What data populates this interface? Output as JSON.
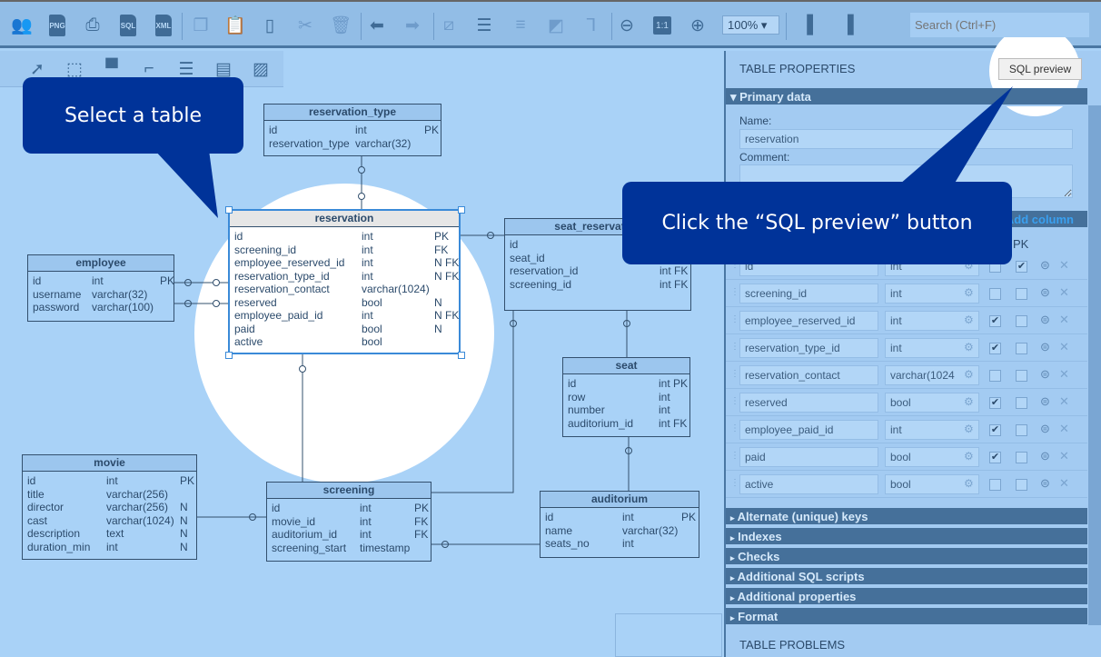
{
  "toolbar": {
    "icons": [
      "users-icon",
      "png-export-icon",
      "print-icon",
      "sql-export-icon",
      "xml-export-icon",
      "copy-icon",
      "paste-icon",
      "paste-special-icon",
      "cut-icon",
      "delete-icon",
      "undo-icon",
      "redo-icon",
      "line-style-icon",
      "align-icon",
      "distribute-icon",
      "arrange-icon",
      "connector-icon",
      "zoom-out-icon",
      "zoom-reset-icon",
      "zoom-in-icon",
      "layout-left-icon",
      "layout-right-icon"
    ],
    "zoom_reset_label": "1:1",
    "png_label": "PNG",
    "sql_label": "SQL",
    "xml_label": "XML",
    "zoom_value": "100%",
    "search_placeholder": "Search (Ctrl+F)"
  },
  "tools": [
    "select-tool-icon",
    "area-select-tool-icon",
    "table-tool-icon",
    "reference-tool-icon",
    "view-tool-icon",
    "note-tool-icon",
    "area-tool-icon"
  ],
  "callouts": {
    "select_table": "Select a table",
    "sql_preview": "Click the “SQL preview” button"
  },
  "tables": [
    {
      "name": "reservation_type",
      "cols": [
        [
          "id",
          "int",
          "PK"
        ],
        [
          "reservation_type",
          "varchar(32)",
          ""
        ]
      ]
    },
    {
      "name": "reservation",
      "cols": [
        [
          "id",
          "int",
          "PK"
        ],
        [
          "screening_id",
          "int",
          "FK"
        ],
        [
          "employee_reserved_id",
          "int",
          "N FK"
        ],
        [
          "reservation_type_id",
          "int",
          "N FK"
        ],
        [
          "reservation_contact",
          "varchar(1024)",
          ""
        ],
        [
          "reserved",
          "bool",
          "N"
        ],
        [
          "employee_paid_id",
          "int",
          "N FK"
        ],
        [
          "paid",
          "bool",
          "N"
        ],
        [
          "active",
          "bool",
          ""
        ]
      ]
    },
    {
      "name": "employee",
      "cols": [
        [
          "id",
          "int",
          "PK"
        ],
        [
          "username",
          "varchar(32)",
          ""
        ],
        [
          "password",
          "varchar(100)",
          ""
        ]
      ]
    },
    {
      "name": "seat_reservation",
      "cols": [
        [
          "id",
          "",
          ""
        ],
        [
          "seat_id",
          "",
          ""
        ],
        [
          "reservation_id",
          "",
          "int FK"
        ],
        [
          "screening_id",
          "",
          "int FK"
        ]
      ]
    },
    {
      "name": "seat",
      "cols": [
        [
          "id",
          "",
          "int PK"
        ],
        [
          "row",
          "",
          "int"
        ],
        [
          "number",
          "",
          "int"
        ],
        [
          "auditorium_id",
          "",
          "int FK"
        ]
      ]
    },
    {
      "name": "movie",
      "cols": [
        [
          "id",
          "int",
          "PK"
        ],
        [
          "title",
          "varchar(256)",
          ""
        ],
        [
          "director",
          "varchar(256)",
          "N"
        ],
        [
          "cast",
          "varchar(1024)",
          "N"
        ],
        [
          "description",
          "text",
          "N"
        ],
        [
          "duration_min",
          "int",
          "N"
        ]
      ]
    },
    {
      "name": "screening",
      "cols": [
        [
          "id",
          "int",
          "PK"
        ],
        [
          "movie_id",
          "int",
          "FK"
        ],
        [
          "auditorium_id",
          "int",
          "FK"
        ],
        [
          "screening_start",
          "timestamp",
          ""
        ]
      ]
    },
    {
      "name": "auditorium",
      "cols": [
        [
          "id",
          "int",
          "PK"
        ],
        [
          "name",
          "varchar(32)",
          ""
        ],
        [
          "seats_no",
          "int",
          ""
        ]
      ]
    }
  ],
  "panel": {
    "title": "TABLE PROPERTIES",
    "sql_preview_label": "SQL preview",
    "primary_data": "Primary data",
    "name_label": "Name:",
    "name_value": "reservation",
    "comment_label": "Comment:",
    "comment_value": "",
    "add_column": "Add column",
    "pk_header": "PK",
    "columns": [
      {
        "name": "id",
        "type": "int",
        "n": false,
        "pk": true
      },
      {
        "name": "screening_id",
        "type": "int",
        "n": false,
        "pk": false
      },
      {
        "name": "employee_reserved_id",
        "type": "int",
        "n": true,
        "pk": false
      },
      {
        "name": "reservation_type_id",
        "type": "int",
        "n": true,
        "pk": false
      },
      {
        "name": "reservation_contact",
        "type": "varchar(1024",
        "n": false,
        "pk": false
      },
      {
        "name": "reserved",
        "type": "bool",
        "n": true,
        "pk": false
      },
      {
        "name": "employee_paid_id",
        "type": "int",
        "n": true,
        "pk": false
      },
      {
        "name": "paid",
        "type": "bool",
        "n": true,
        "pk": false
      },
      {
        "name": "active",
        "type": "bool",
        "n": false,
        "pk": false
      }
    ],
    "sections": [
      "Alternate (unique) keys",
      "Indexes",
      "Checks",
      "Additional SQL scripts",
      "Additional properties",
      "Format"
    ],
    "problems_title": "TABLE PROBLEMS"
  },
  "colors": {
    "accent": "#003399",
    "toolbar": "#92bde6",
    "canvas": "#a9d2f7",
    "section_bar": "#45709a"
  }
}
